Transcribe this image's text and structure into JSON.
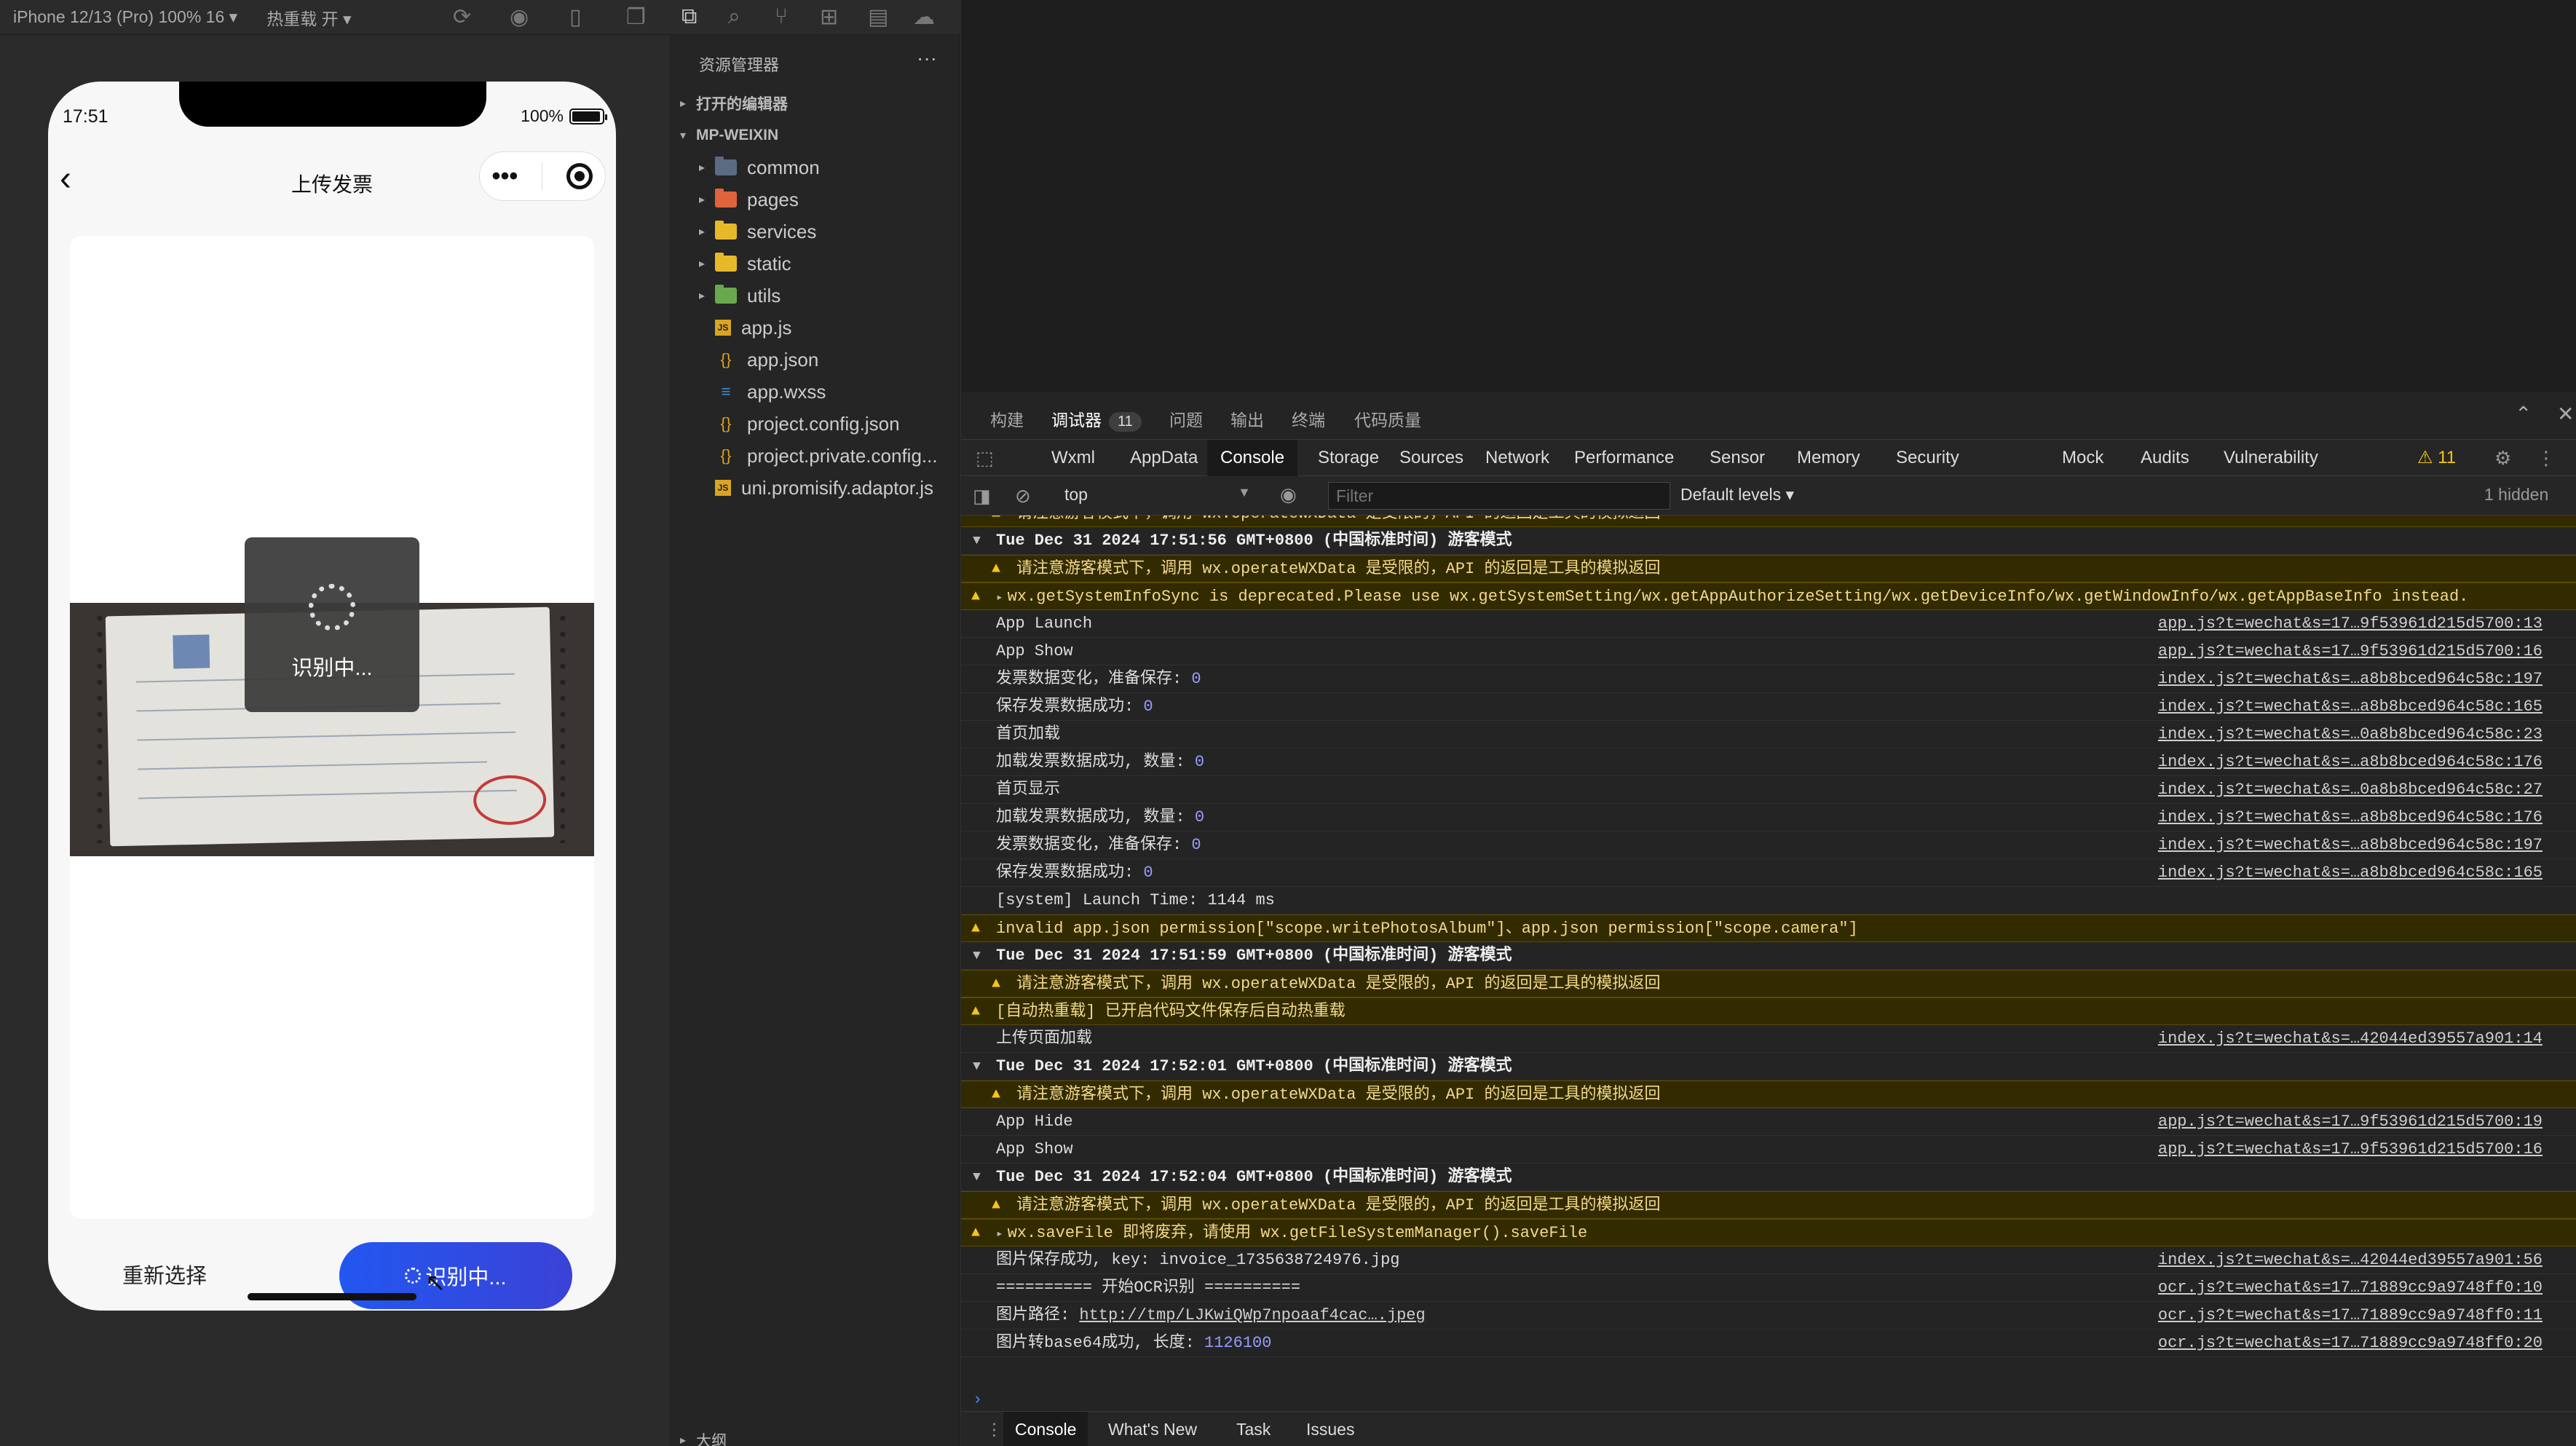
{
  "toolbar": {
    "device": "iPhone 12/13 (Pro) 100% 16 ▾",
    "hot_reload": "热重载 开 ▾"
  },
  "phone": {
    "time": "17:51",
    "battery": "100%",
    "title": "上传发票",
    "loading_text": "识别中...",
    "reselect_label": "重新选择",
    "recognize_label": "识别中..."
  },
  "explorer": {
    "header": "资源管理器",
    "open_editors": "打开的编辑器",
    "project": "MP-WEIXIN",
    "items": [
      {
        "label": "common",
        "type": "folder",
        "color": "#5b6b82"
      },
      {
        "label": "pages",
        "type": "folder",
        "color": "#e0633c"
      },
      {
        "label": "services",
        "type": "folder",
        "color": "#e8b82b"
      },
      {
        "label": "static",
        "type": "folder",
        "color": "#e8b82b"
      },
      {
        "label": "utils",
        "type": "folder",
        "color": "#6aa84f"
      },
      {
        "label": "app.js",
        "type": "js"
      },
      {
        "label": "app.json",
        "type": "json"
      },
      {
        "label": "app.wxss",
        "type": "css"
      },
      {
        "label": "project.config.json",
        "type": "json"
      },
      {
        "label": "project.private.config...",
        "type": "json"
      },
      {
        "label": "uni.promisify.adaptor.js",
        "type": "js"
      }
    ],
    "outline": "大纲"
  },
  "devtools": {
    "top_tabs": [
      "构建",
      "调试器",
      "问题",
      "输出",
      "终端",
      "代码质量"
    ],
    "debugger_badge": "11",
    "panel_tabs": [
      "Wxml",
      "AppData",
      "Console",
      "Storage",
      "Sources",
      "Network",
      "Performance",
      "Sensor",
      "Memory",
      "Security",
      "Mock",
      "Audits",
      "Vulnerability"
    ],
    "warn_count": "⚠ 11",
    "context": "top",
    "filter_placeholder": "Filter",
    "levels": "Default levels ▾",
    "hidden": "1 hidden",
    "bottom_tabs": [
      "Console",
      "What's New",
      "Task",
      "Issues"
    ]
  },
  "console_lines": [
    {
      "kind": "warn-indent",
      "text": "请注意游客模式下，调用 wx.operateWXData 是受限的，API 的返回是工具的模拟返回",
      "src": ""
    },
    {
      "kind": "group",
      "text": "Tue Dec 31 2024 17:51:56 GMT+0800 (中国标准时间) 游客模式",
      "src": ""
    },
    {
      "kind": "warn-indent",
      "text": "请注意游客模式下，调用 wx.operateWXData 是受限的，API 的返回是工具的模拟返回",
      "src": ""
    },
    {
      "kind": "warn-caret",
      "text": "wx.getSystemInfoSync is deprecated.Please use wx.getSystemSetting/wx.getAppAuthorizeSetting/wx.getDeviceInfo/wx.getWindowInfo/wx.getAppBaseInfo instead.",
      "src": ""
    },
    {
      "kind": "log",
      "text": "App Launch",
      "src": "app.js?t=wechat&s=17…9f53961d215d5700:13"
    },
    {
      "kind": "log",
      "text": "App Show",
      "src": "app.js?t=wechat&s=17…9f53961d215d5700:16"
    },
    {
      "kind": "log",
      "text": "发票数据变化，准备保存:",
      "num": "0",
      "src": "index.js?t=wechat&s=…a8b8bced964c58c:197"
    },
    {
      "kind": "log",
      "text": "保存发票数据成功:",
      "num": "0",
      "src": "index.js?t=wechat&s=…a8b8bced964c58c:165"
    },
    {
      "kind": "log",
      "text": "首页加载",
      "src": "index.js?t=wechat&s=…0a8b8bced964c58c:23"
    },
    {
      "kind": "log",
      "text": "加载发票数据成功, 数量:",
      "num": "0",
      "src": "index.js?t=wechat&s=…a8b8bced964c58c:176"
    },
    {
      "kind": "log",
      "text": "首页显示",
      "src": "index.js?t=wechat&s=…0a8b8bced964c58c:27"
    },
    {
      "kind": "log",
      "text": "加载发票数据成功, 数量:",
      "num": "0",
      "src": "index.js?t=wechat&s=…a8b8bced964c58c:176"
    },
    {
      "kind": "log",
      "text": "发票数据变化，准备保存:",
      "num": "0",
      "src": "index.js?t=wechat&s=…a8b8bced964c58c:197"
    },
    {
      "kind": "log",
      "text": "保存发票数据成功:",
      "num": "0",
      "src": "index.js?t=wechat&s=…a8b8bced964c58c:165"
    },
    {
      "kind": "log",
      "text": "[system] Launch Time: 1144 ms",
      "src": ""
    },
    {
      "kind": "warn",
      "text": "invalid app.json permission[\"scope.writePhotosAlbum\"]、app.json permission[\"scope.camera\"]",
      "src": ""
    },
    {
      "kind": "group",
      "text": "Tue Dec 31 2024 17:51:59 GMT+0800 (中国标准时间) 游客模式",
      "src": ""
    },
    {
      "kind": "warn-indent",
      "text": "请注意游客模式下，调用 wx.operateWXData 是受限的，API 的返回是工具的模拟返回",
      "src": ""
    },
    {
      "kind": "warn",
      "text": "[自动热重载] 已开启代码文件保存后自动热重载",
      "src": ""
    },
    {
      "kind": "log",
      "text": "上传页面加载",
      "src": "index.js?t=wechat&s=…42044ed39557a901:14"
    },
    {
      "kind": "group",
      "text": "Tue Dec 31 2024 17:52:01 GMT+0800 (中国标准时间) 游客模式",
      "src": ""
    },
    {
      "kind": "warn-indent",
      "text": "请注意游客模式下，调用 wx.operateWXData 是受限的，API 的返回是工具的模拟返回",
      "src": ""
    },
    {
      "kind": "log",
      "text": "App Hide",
      "src": "app.js?t=wechat&s=17…9f53961d215d5700:19"
    },
    {
      "kind": "log",
      "text": "App Show",
      "src": "app.js?t=wechat&s=17…9f53961d215d5700:16"
    },
    {
      "kind": "group",
      "text": "Tue Dec 31 2024 17:52:04 GMT+0800 (中国标准时间) 游客模式",
      "src": ""
    },
    {
      "kind": "warn-indent",
      "text": "请注意游客模式下，调用 wx.operateWXData 是受限的，API 的返回是工具的模拟返回",
      "src": ""
    },
    {
      "kind": "warn-caret",
      "text": "wx.saveFile 即将废弃，请使用 wx.getFileSystemManager().saveFile",
      "src": ""
    },
    {
      "kind": "log",
      "text": "图片保存成功, key: invoice_1735638724976.jpg",
      "src": "index.js?t=wechat&s=…42044ed39557a901:56"
    },
    {
      "kind": "log",
      "text": "========== 开始OCR识别 ==========",
      "src": "ocr.js?t=wechat&s=17…71889cc9a9748ff0:10"
    },
    {
      "kind": "log",
      "text": "图片路径:",
      "link": "http://tmp/LJKwiQWp7npoaaf4cac….jpeg",
      "src": "ocr.js?t=wechat&s=17…71889cc9a9748ff0:11"
    },
    {
      "kind": "log",
      "text": "图片转base64成功, 长度:",
      "num": "1126100",
      "src": "ocr.js?t=wechat&s=17…71889cc9a9748ff0:20"
    }
  ]
}
